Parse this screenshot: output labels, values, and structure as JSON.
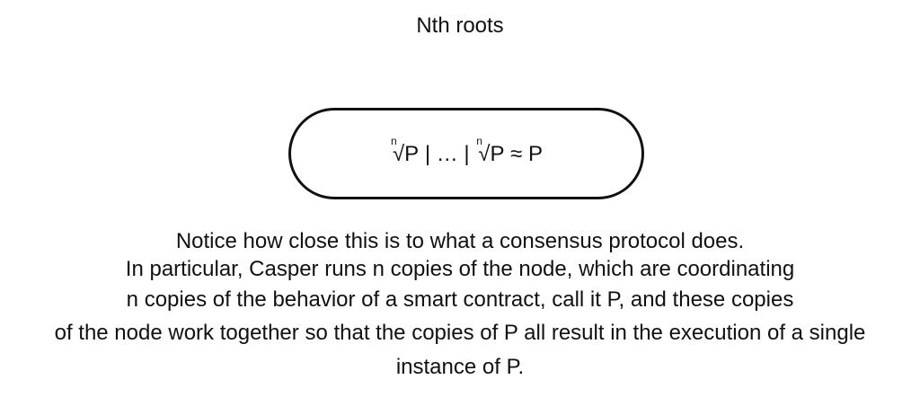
{
  "slide": {
    "title": "Nth roots"
  },
  "formula": {
    "root_index": "n",
    "radical_sign": "√",
    "operand": "P",
    "separator": " | … | ",
    "approx_symbol": " ≈ ",
    "result": "P"
  },
  "body": {
    "lines": [
      "Notice how close this is to what a consensus protocol does.",
      "In particular, Casper runs n copies of the node, which are coordinating",
      "n copies of the behavior of a smart contract, call it P, and these copies",
      "of the node work together so that the copies of P all result in the execution of a single",
      "instance of P."
    ]
  }
}
